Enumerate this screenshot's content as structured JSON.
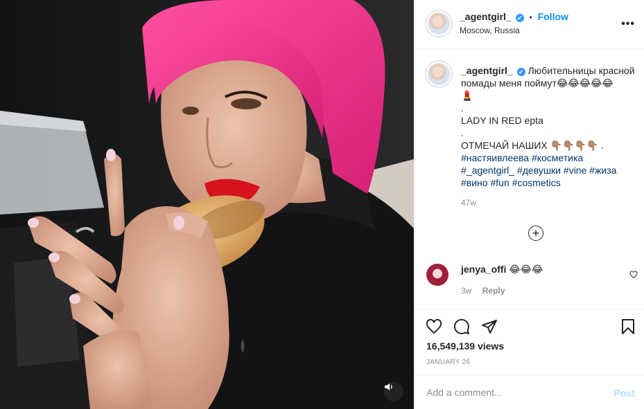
{
  "post": {
    "author": "_agentgirl_",
    "location": "Moscow, Russia",
    "follow_label": "Follow",
    "dot": "•",
    "more_label": "•••",
    "verified_mark": "✔"
  },
  "caption": {
    "author": "_agentgirl_",
    "line1": "Любительницы красной помады меня поймут😂😂😂😂😂",
    "line2": "💄",
    "line3": ".",
    "line4": "LADY IN RED epta",
    "line5": ".",
    "line6": "ОТМЕЧАЙ НАШИХ 👇🏽👇🏽👇🏽👇🏽 .",
    "hashtags": [
      "#настяивлеева",
      "#косметика",
      "#_agentgirl_",
      "#девушки",
      "#vine",
      "#жиза",
      "#вино",
      "#fun",
      "#cosmetics"
    ],
    "time_ago": "47w"
  },
  "load_more": "+",
  "comments": [
    {
      "user": "jenya_offi",
      "text": "😂😂😂",
      "time": "3w",
      "reply_label": "Reply"
    }
  ],
  "stats": {
    "views": "16,549,139 views",
    "date": "JANUARY 26"
  },
  "comment_input": {
    "placeholder": "Add a comment...",
    "post_label": "Post"
  },
  "colors": {
    "accent": "#0095f6",
    "hashtag": "#00376b",
    "post_disabled": "#b2dffc",
    "hair": "#ef2f86",
    "sweater": "#131314"
  },
  "icons": [
    "sound-icon",
    "more-icon",
    "verified-icon",
    "load-more-icon",
    "like-icon",
    "comment-icon",
    "share-icon",
    "save-icon",
    "small-heart-icon"
  ]
}
